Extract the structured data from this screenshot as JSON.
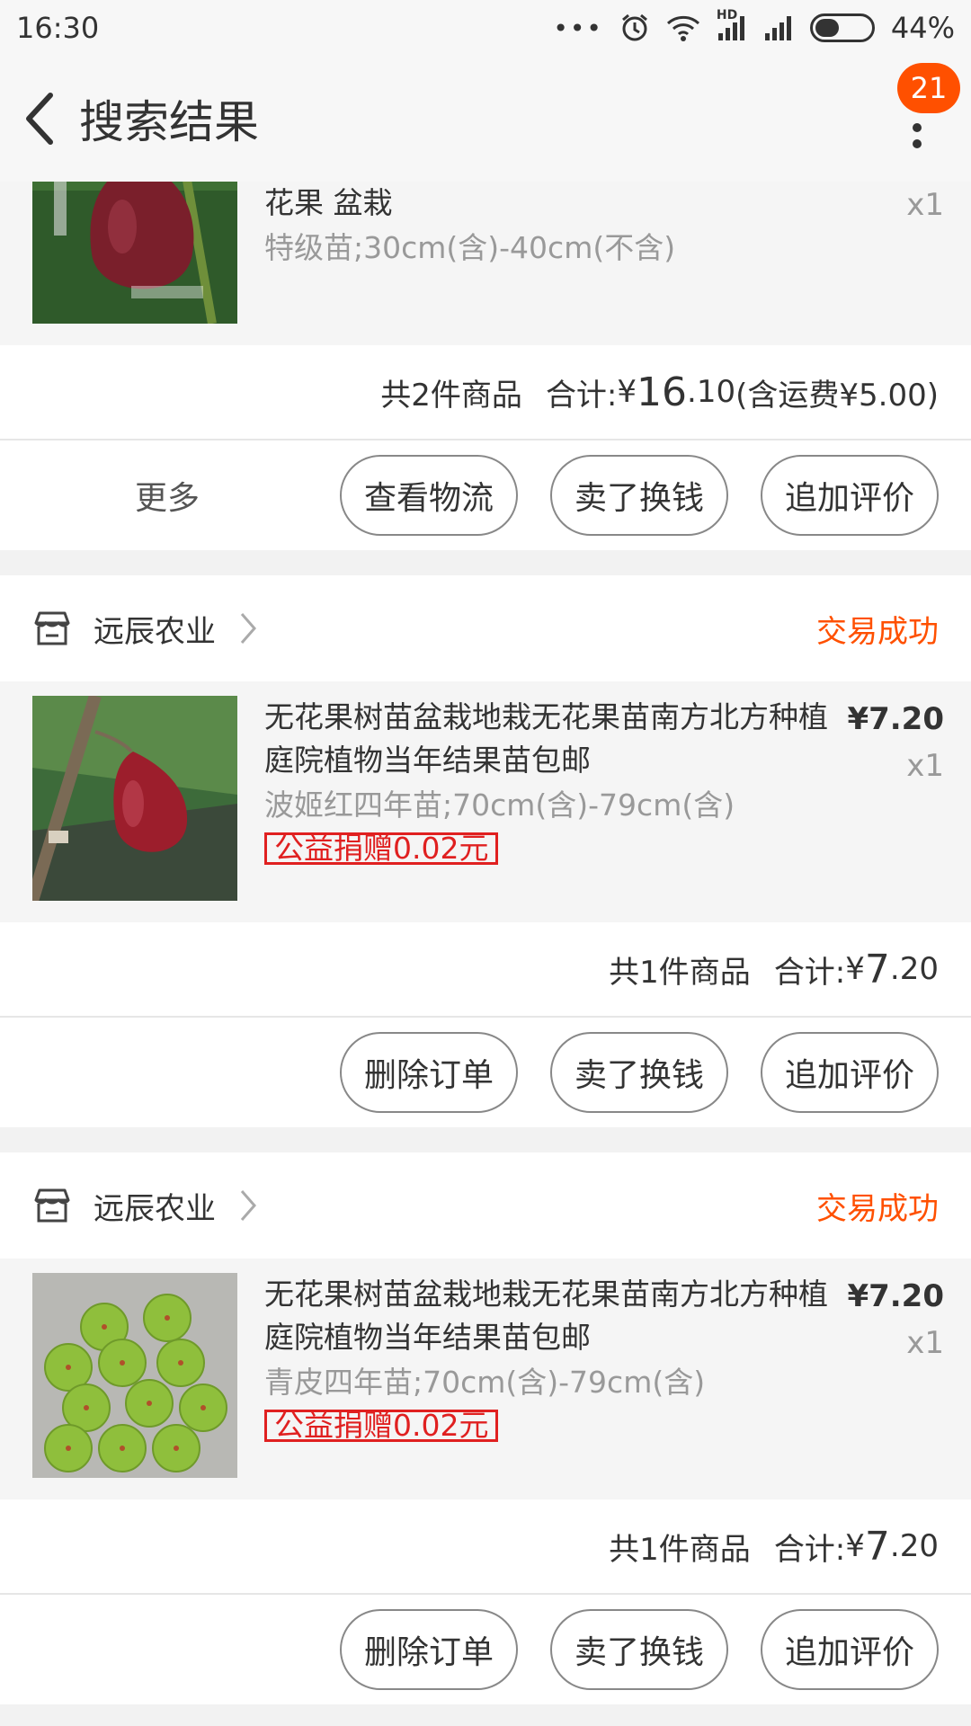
{
  "status_bar": {
    "time": "16:30",
    "dots": "•••",
    "hd": "HD",
    "battery_percent": "44%",
    "battery_level": 0.44
  },
  "nav": {
    "title": "搜索结果",
    "badge": "21"
  },
  "orders": [
    {
      "items": [
        {
          "title": "花果 盆栽",
          "spec": "特级苗;30cm(含)-40cm(不含)",
          "qty": "x1"
        }
      ],
      "summary": {
        "count": "共2件商品",
        "total_label": "合计: ",
        "currency": "¥",
        "amount_int": "16",
        "amount_dec": ".10",
        "shipping": " (含运费¥5.00)"
      },
      "more_label": "更多",
      "buttons": [
        "查看物流",
        "卖了换钱",
        "追加评价"
      ]
    },
    {
      "shop": "远辰农业",
      "status": "交易成功",
      "items": [
        {
          "title": "无花果树苗盆栽地栽无花果苗南方北方种植庭院植物当年结果苗包邮",
          "spec": "波姬红四年苗;70cm(含)-79cm(含)",
          "donate": "公益捐赠0.02元",
          "price": "¥7.20",
          "qty": "x1"
        }
      ],
      "summary": {
        "count": "共1件商品",
        "total_label": "合计: ",
        "currency": "¥",
        "amount_int": "7",
        "amount_dec": ".20"
      },
      "buttons": [
        "删除订单",
        "卖了换钱",
        "追加评价"
      ]
    },
    {
      "shop": "远辰农业",
      "status": "交易成功",
      "items": [
        {
          "title": "无花果树苗盆栽地栽无花果苗南方北方种植庭院植物当年结果苗包邮",
          "spec": "青皮四年苗;70cm(含)-79cm(含)",
          "donate": "公益捐赠0.02元",
          "price": "¥7.20",
          "qty": "x1"
        }
      ],
      "summary": {
        "count": "共1件商品",
        "total_label": "合计: ",
        "currency": "¥",
        "amount_int": "7",
        "amount_dec": ".20"
      },
      "buttons": [
        "删除订单",
        "卖了换钱",
        "追加评价"
      ]
    }
  ],
  "colors": {
    "accent": "#ff5000",
    "donate": "#e02020"
  },
  "icons": {
    "shop": "store-icon",
    "chevron": "chevron-right-icon",
    "back": "back-arrow-icon",
    "more": "more-vertical-icon"
  }
}
